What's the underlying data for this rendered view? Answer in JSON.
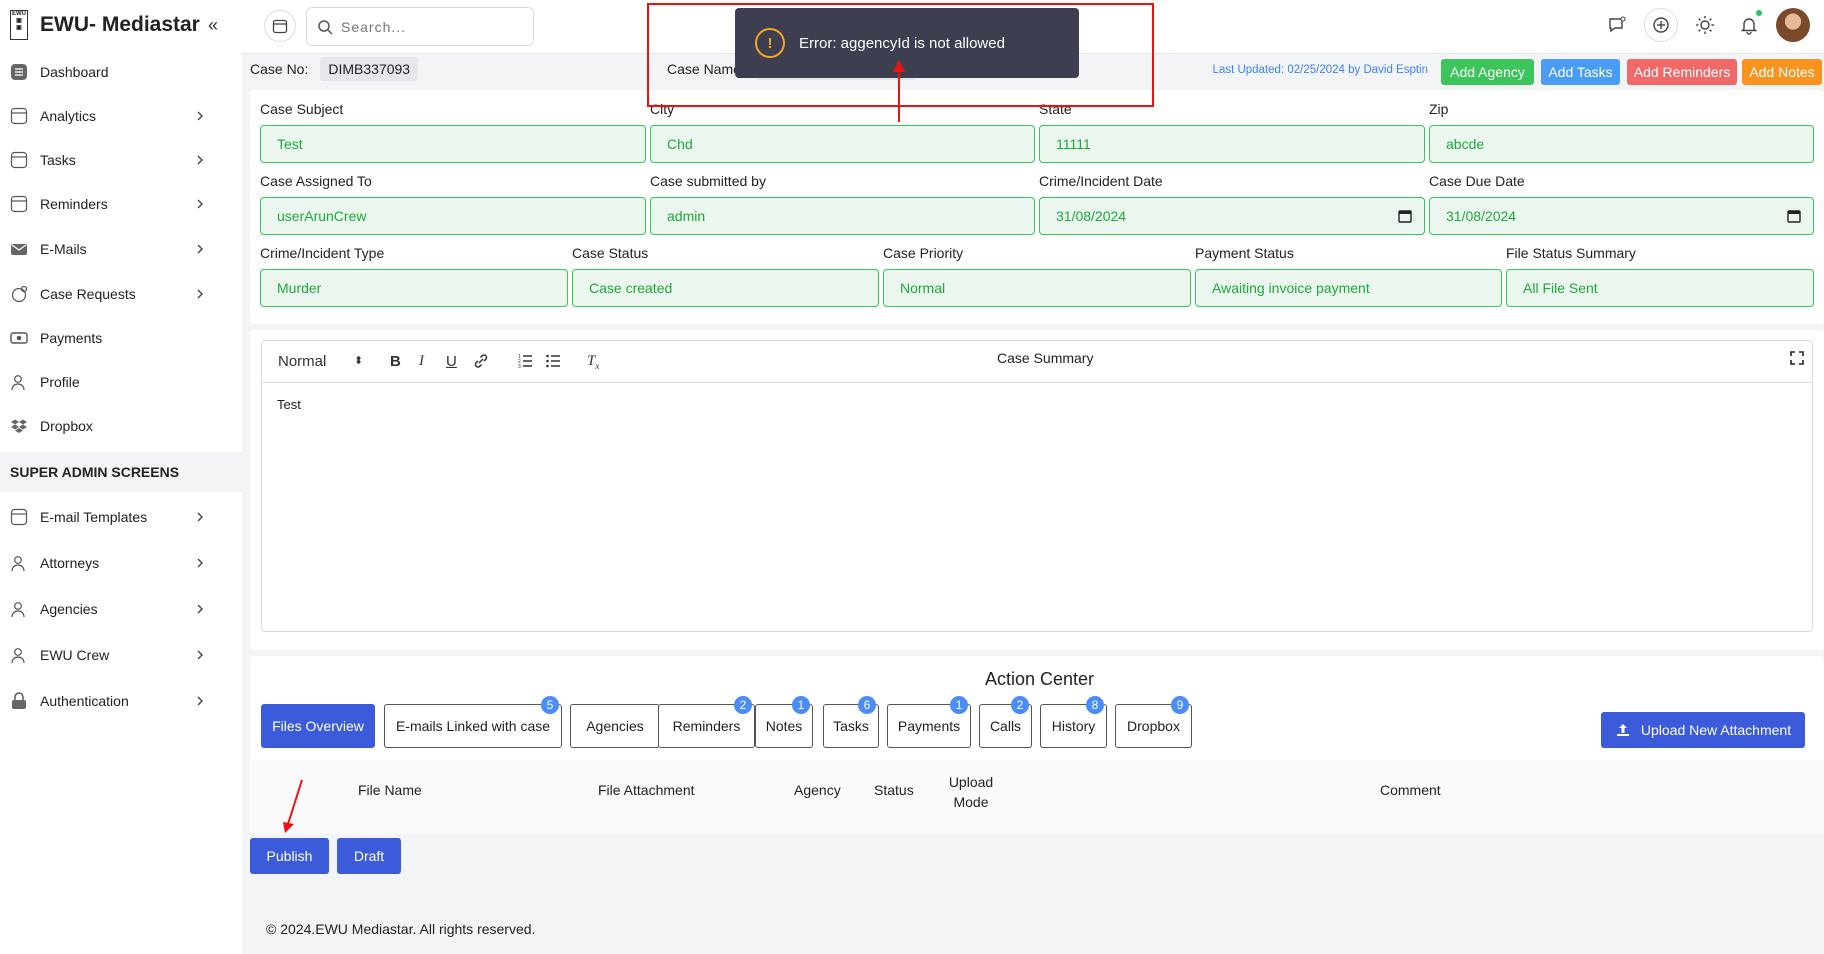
{
  "brand": {
    "title": "EWU- Mediastar",
    "logo_text": "EWU"
  },
  "sidebar": {
    "items": [
      {
        "label": "Dashboard",
        "icon": "dashboard-icon",
        "chevron": false
      },
      {
        "label": "Analytics",
        "icon": "analytics-icon",
        "chevron": true
      },
      {
        "label": "Tasks",
        "icon": "tasks-icon",
        "chevron": true
      },
      {
        "label": "Reminders",
        "icon": "reminders-icon",
        "chevron": true
      },
      {
        "label": "E-Mails",
        "icon": "mail-icon",
        "chevron": true
      },
      {
        "label": "Case Requests",
        "icon": "case-requests-icon",
        "chevron": true
      },
      {
        "label": "Payments",
        "icon": "payments-icon",
        "chevron": false
      },
      {
        "label": "Profile",
        "icon": "profile-icon",
        "chevron": false
      },
      {
        "label": "Dropbox",
        "icon": "dropbox-icon",
        "chevron": false
      }
    ],
    "section_title": "SUPER ADMIN SCREENS",
    "admin_items": [
      {
        "label": "E-mail Templates",
        "icon": "templates-icon",
        "chevron": true
      },
      {
        "label": "Attorneys",
        "icon": "attorneys-icon",
        "chevron": true
      },
      {
        "label": "Agencies",
        "icon": "agencies-icon",
        "chevron": true
      },
      {
        "label": "EWU Crew",
        "icon": "crew-icon",
        "chevron": true
      },
      {
        "label": "Authentication",
        "icon": "lock-icon",
        "chevron": true
      }
    ]
  },
  "topbar": {
    "search_placeholder": "Search..."
  },
  "case_header": {
    "case_no_label": "Case No:",
    "case_no_value": "DIMB337093",
    "case_name_label": "Case Name",
    "last_updated": "Last Updated: 02/25/2024 by David Esptin",
    "buttons": {
      "add_agency": "Add Agency",
      "add_tasks": "Add Tasks",
      "add_reminders": "Add Reminders",
      "add_notes": "Add Notes"
    },
    "colors": {
      "add_agency": "#3cc55a",
      "add_tasks": "#4b9cf5",
      "add_reminders": "#f16868",
      "add_notes": "#f7931e"
    }
  },
  "form": {
    "case_subject": {
      "label": "Case Subject",
      "value": "Test"
    },
    "city": {
      "label": "City",
      "value": "Chd"
    },
    "state": {
      "label": "State",
      "value": "11111"
    },
    "zip": {
      "label": "Zip",
      "value": "abcde"
    },
    "assigned_to": {
      "label": "Case Assigned To",
      "value": "userArunCrew"
    },
    "submitted_by": {
      "label": "Case submitted by",
      "value": "admin"
    },
    "incident_date": {
      "label": "Crime/Incident Date",
      "value": "31/08/2024"
    },
    "due_date": {
      "label": "Case Due Date",
      "value": "31/08/2024"
    },
    "incident_type": {
      "label": "Crime/Incident Type",
      "value": "Murder"
    },
    "case_status": {
      "label": "Case Status",
      "value": "Case created"
    },
    "case_priority": {
      "label": "Case Priority",
      "value": "Normal"
    },
    "payment_status": {
      "label": "Payment Status",
      "value": "Awaiting invoice payment"
    },
    "file_status": {
      "label": "File Status Summary",
      "value": "All File Sent"
    }
  },
  "editor": {
    "format_select": "Normal",
    "title": "Case Summary",
    "content": "Test"
  },
  "action_center": {
    "title": "Action Center",
    "tabs": [
      {
        "label": "Files Overview",
        "badge": ""
      },
      {
        "label": "E-mails Linked with case",
        "badge": "5"
      },
      {
        "label": "Agencies",
        "badge": ""
      },
      {
        "label": "Reminders",
        "badge": "2"
      },
      {
        "label": "Notes",
        "badge": "1"
      },
      {
        "label": "Tasks",
        "badge": "6"
      },
      {
        "label": "Payments",
        "badge": "1"
      },
      {
        "label": "Calls",
        "badge": "2"
      },
      {
        "label": "History",
        "badge": "8"
      },
      {
        "label": "Dropbox",
        "badge": "9"
      }
    ],
    "upload_label": "Upload New Attachment",
    "columns": [
      "File Name",
      "File Attachment",
      "Agency",
      "Status",
      "Upload Mode",
      "Comment"
    ]
  },
  "actions": {
    "publish": "Publish",
    "draft": "Draft"
  },
  "footer": "© 2024.EWU Mediastar. All rights reserved.",
  "toast": {
    "message": "Error: aggencyId is not allowed",
    "icon": "warning-icon"
  }
}
